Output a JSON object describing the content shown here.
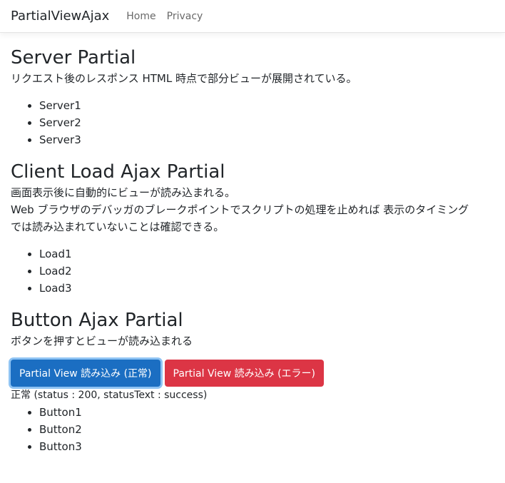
{
  "navbar": {
    "brand": "PartialViewAjax",
    "links": [
      "Home",
      "Privacy"
    ]
  },
  "server_partial": {
    "title": "Server Partial",
    "description": "リクエスト後のレスポンス HTML 時点で部分ビューが展開されている。",
    "items": [
      "Server1",
      "Server2",
      "Server3"
    ]
  },
  "client_load": {
    "title": "Client Load Ajax Partial",
    "lines": [
      "画面表示後に自動的にビューが読み込まれる。",
      "Web ブラウザのデバッガのブレークポイントでスクリプトの処理を止めれば 表示のタイミング",
      "では読み込まれていないことは確認できる。"
    ],
    "items": [
      "Load1",
      "Load2",
      "Load3"
    ]
  },
  "button_ajax": {
    "title": "Button Ajax Partial",
    "description": "ボタンを押すとビューが読み込まれる",
    "buttons": {
      "normal": "Partial View 読み込み (正常)",
      "error": "Partial View 読み込み (エラー)"
    },
    "status": "正常 (status : 200, statusText : success)",
    "items": [
      "Button1",
      "Button2",
      "Button3"
    ]
  },
  "colors": {
    "primary": "#1b6ec2",
    "danger": "#dc3545"
  }
}
